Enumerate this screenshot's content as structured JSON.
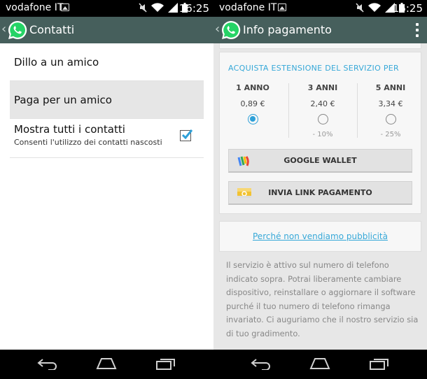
{
  "status_bar": {
    "carrier": "vodafone IT",
    "time": "16:25"
  },
  "left": {
    "app_title": "Contatti",
    "menu_items": [
      {
        "label": "Dillo a un amico"
      },
      {
        "label": "Paga per un amico"
      }
    ],
    "show_all": {
      "label": "Mostra tutti i contatti",
      "sublabel": "Consenti l'utilizzo dei contatti nascosti",
      "checked": true
    }
  },
  "right": {
    "app_title": "Info pagamento",
    "plans_heading": "ACQUISTA ESTENSIONE DEL SERVIZIO PER",
    "plans": [
      {
        "name": "1 ANNO",
        "price": "0,89 €",
        "discount": "",
        "selected": true
      },
      {
        "name": "3 ANNI",
        "price": "2,40 €",
        "discount": "- 10%",
        "selected": false
      },
      {
        "name": "5 ANNI",
        "price": "3,34 €",
        "discount": "- 25%",
        "selected": false
      }
    ],
    "google_wallet_label": "GOOGLE WALLET",
    "send_link_label": "INVIA LINK PAGAMENTO",
    "why_no_ads_link": "Perché non vendiamo pubblicità",
    "info_text": "Il servizio è attivo sul numero di telefono indicato sopra. Potrai liberamente cambiare dispositivo, reinstallare o aggiornare il software purché il tuo numero di telefono rimanga invariato. Ci auguriamo che il nostro servizio sia di tuo gradimento."
  },
  "colors": {
    "action_bar": "#465f5c",
    "accent": "#36a8d8",
    "whatsapp_green": "#25d366"
  },
  "icons": [
    "back-chevron-icon",
    "whatsapp-logo-icon",
    "overflow-menu-icon",
    "checkbox-checked-icon",
    "google-wallet-icon",
    "link-payment-icon",
    "nav-back-icon",
    "nav-home-icon",
    "nav-recents-icon",
    "wifi-icon",
    "signal-icon",
    "mute-icon",
    "battery-icon",
    "image-notification-icon"
  ]
}
